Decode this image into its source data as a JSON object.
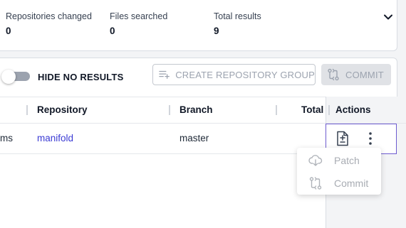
{
  "stats": [
    {
      "label": "Repositories changed",
      "value": "0"
    },
    {
      "label": "Files searched",
      "value": "0"
    },
    {
      "label": "Total results",
      "value": "9"
    }
  ],
  "toolbar": {
    "hide_no_results_label": "HIDE NO RESULTS",
    "hide_no_results_on": false,
    "create_group_label": "CREATE REPOSITORY GROUP",
    "commit_label": "COMMIT"
  },
  "table": {
    "headers": [
      "Repository",
      "Branch",
      "Total",
      "Actions"
    ],
    "rows": [
      {
        "name_fragment": "ms",
        "repository": "manifold",
        "branch": "master",
        "total": ""
      }
    ]
  },
  "menu": {
    "items": [
      {
        "label": "Patch",
        "icon": "cloud-download-icon"
      },
      {
        "label": "Commit",
        "icon": "git-compare-icon"
      }
    ]
  },
  "colors": {
    "link": "#3b3bd4",
    "selected_border": "#6d5bd0"
  }
}
